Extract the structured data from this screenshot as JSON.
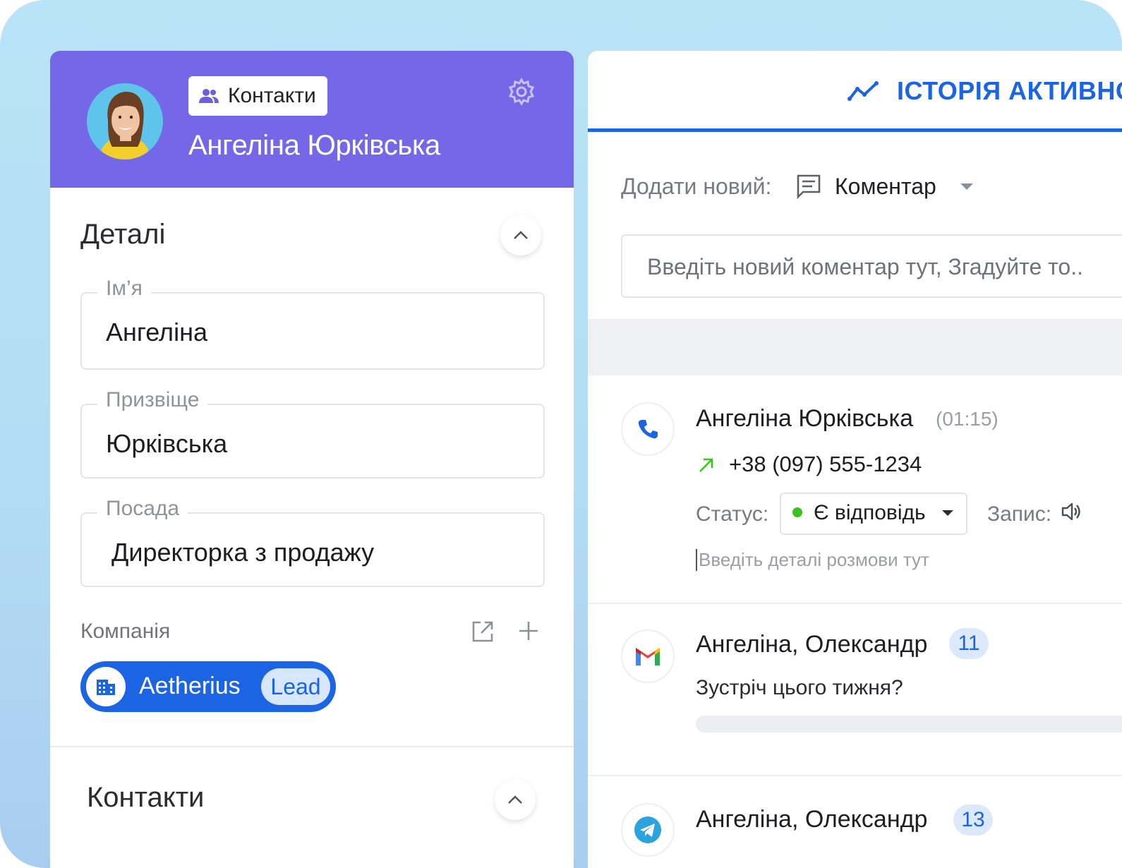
{
  "contact": {
    "breadcrumb_label": "Контакти",
    "full_name": "Ангеліна Юрківська"
  },
  "details": {
    "title": "Деталі",
    "fields": [
      {
        "label": "Ім’я",
        "value": "Ангеліна"
      },
      {
        "label": "Призвіще",
        "value": "Юрківська"
      },
      {
        "label": "Посада",
        "value": "Директорка з продажу"
      }
    ],
    "company": {
      "label": "Компанія",
      "name": "Aetherius",
      "tag": "Lead"
    }
  },
  "contacts_section": {
    "title": "Контакти"
  },
  "activity": {
    "tab_label": "ІСТОРІЯ АКТИВНО",
    "add_new_label": "Додати новий:",
    "add_new_type": "Коментар",
    "comment_placeholder": "Введіть новий коментар тут, Згадуйте то..",
    "items": [
      {
        "kind": "call",
        "icon": "phone-icon",
        "name": "Ангеліна Юрківська",
        "duration": "(01:15)",
        "phone": "+38 (097) 555-1234",
        "status_label": "Статус:",
        "status_value": "Є відповідь",
        "record_label": "Запис:",
        "details_placeholder": "Введіть деталі розмови тут"
      },
      {
        "kind": "email",
        "icon": "gmail-icon",
        "name": "Ангеліна, Олександр",
        "count": "11",
        "subject": "Зустріч цього тижня?"
      },
      {
        "kind": "telegram",
        "icon": "telegram-icon",
        "name": "Ангеліна, Олександр",
        "count": "13"
      }
    ]
  },
  "colors": {
    "header_purple": "#7568e8",
    "accent_blue": "#1b64e3",
    "status_green": "#3cc21d",
    "outgoing_arrow_green": "#3cc21d",
    "background_sky": "#b9e3f7"
  }
}
